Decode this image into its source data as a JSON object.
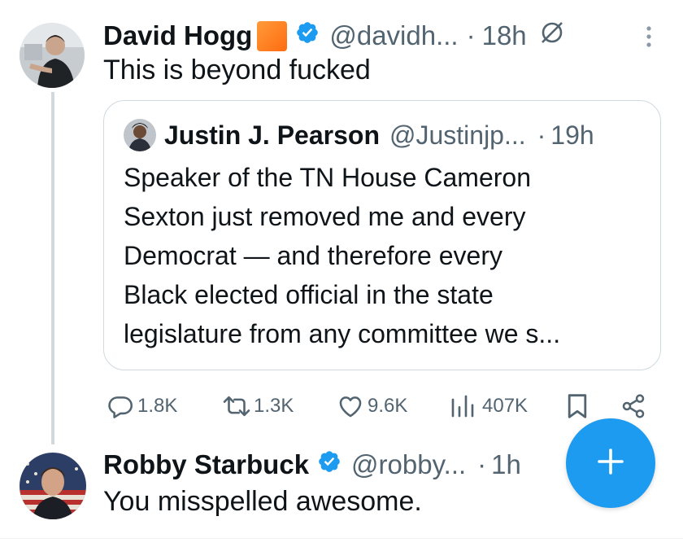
{
  "tweet1": {
    "name": "David Hogg",
    "handle": "@davidh...",
    "dot": "·",
    "time": "18h",
    "text": "This is beyond fucked",
    "flag_color": "#ff7a1a"
  },
  "quote": {
    "name": "Justin J. Pearson",
    "handle": "@Justinjp...",
    "dot": "·",
    "time": "19h",
    "lines": [
      "Speaker of the TN House Cameron",
      "Sexton just removed me and every",
      "Democrat — and therefore every",
      "Black elected official in the state",
      "legislature from any committee we s..."
    ]
  },
  "actions": {
    "replies": "1.8K",
    "retweets": "1.3K",
    "likes": "9.6K",
    "views": "407K"
  },
  "tweet2": {
    "name": "Robby Starbuck",
    "handle": "@robby...",
    "dot": "·",
    "time": "1h",
    "text": "You misspelled awesome."
  },
  "colors": {
    "accent": "#1d9bf0",
    "muted": "#536471",
    "text": "#0f1419",
    "border": "#cfd9de"
  },
  "icons": {
    "fab": "plus-icon",
    "grok": "grok-icon",
    "more": "more-vertical-icon"
  }
}
